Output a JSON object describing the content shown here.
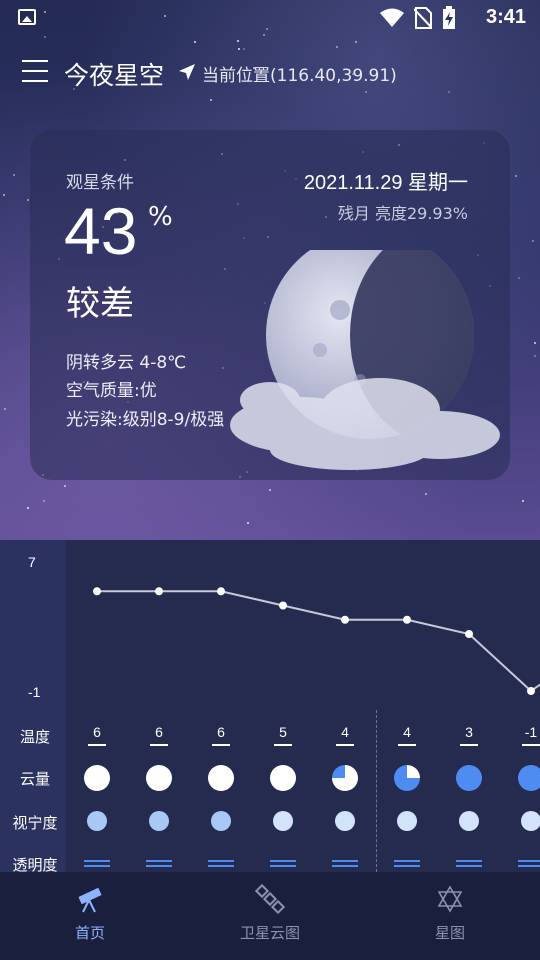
{
  "status_bar": {
    "time": "3:41",
    "icons": [
      "image-icon",
      "wifi-icon",
      "no-sim-icon",
      "battery-charging-icon"
    ]
  },
  "header": {
    "title": "今夜星空",
    "location": "当前位置(116.40,39.91)"
  },
  "card": {
    "condition_label": "观星条件",
    "percent": "43",
    "percent_sign": "%",
    "quality": "较差",
    "weather": "阴转多云 4-8℃",
    "air": "空气质量:优",
    "light_pollution": "光污染:级别8-9/极强",
    "date": "2021.11.29 星期一",
    "moon_phase": "残月 亮度29.93%"
  },
  "chart_data": {
    "type": "line",
    "y_ticks": [
      "7",
      "-1"
    ],
    "ylim": [
      -1,
      7
    ],
    "values": [
      6,
      6,
      6,
      5,
      4,
      4,
      3,
      -1
    ]
  },
  "table": {
    "row_labels": {
      "temperature": "温度",
      "cloud": "云量",
      "seeing": "视宁度",
      "transparency": "透明度"
    },
    "temperature": [
      "6",
      "6",
      "6",
      "5",
      "4",
      "4",
      "3",
      "-1"
    ],
    "cloud_cover": [
      1,
      1,
      1,
      1,
      0.75,
      0.25,
      0,
      0
    ],
    "seeing_colors": [
      "#a9c8f6",
      "#a9c8f6",
      "#a9c8f6",
      "#d3e3fb",
      "#d3e3fb",
      "#d3e3fb",
      "#d3e3fb",
      "#d3e3fb"
    ]
  },
  "colors": {
    "accent": "#4f8cf2",
    "active_nav": "#8fb2ff",
    "inactive_nav": "#8d91b0"
  },
  "nav": [
    {
      "label": "首页",
      "icon": "telescope-icon",
      "active": true
    },
    {
      "label": "卫星云图",
      "icon": "satellite-icon",
      "active": false
    },
    {
      "label": "星图",
      "icon": "star-chart-icon",
      "active": false
    }
  ]
}
